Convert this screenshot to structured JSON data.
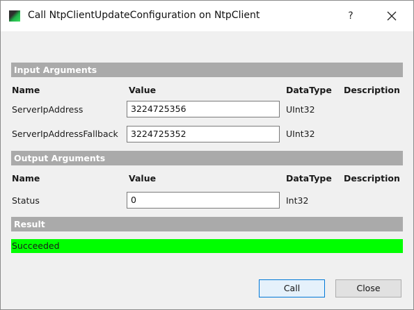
{
  "window": {
    "title": "Call NtpClientUpdateConfiguration on NtpClient",
    "help_label": "?",
    "app_icon": "app-icon",
    "close_icon": "close-icon"
  },
  "input_arguments": {
    "header": "Input Arguments",
    "columns": {
      "name": "Name",
      "value": "Value",
      "datatype": "DataType",
      "description": "Description"
    },
    "rows": [
      {
        "name": "ServerIpAddress",
        "value": "3224725356",
        "datatype": "UInt32",
        "description": ""
      },
      {
        "name": "ServerIpAddressFallback",
        "value": "3224725352",
        "datatype": "UInt32",
        "description": ""
      }
    ]
  },
  "output_arguments": {
    "header": "Output Arguments",
    "columns": {
      "name": "Name",
      "value": "Value",
      "datatype": "DataType",
      "description": "Description"
    },
    "rows": [
      {
        "name": "Status",
        "value": "0",
        "datatype": "Int32",
        "description": ""
      }
    ]
  },
  "result": {
    "header": "Result",
    "text": "Succeeded",
    "color": "#00ff00"
  },
  "buttons": {
    "call_label": "Call",
    "close_label": "Close"
  }
}
